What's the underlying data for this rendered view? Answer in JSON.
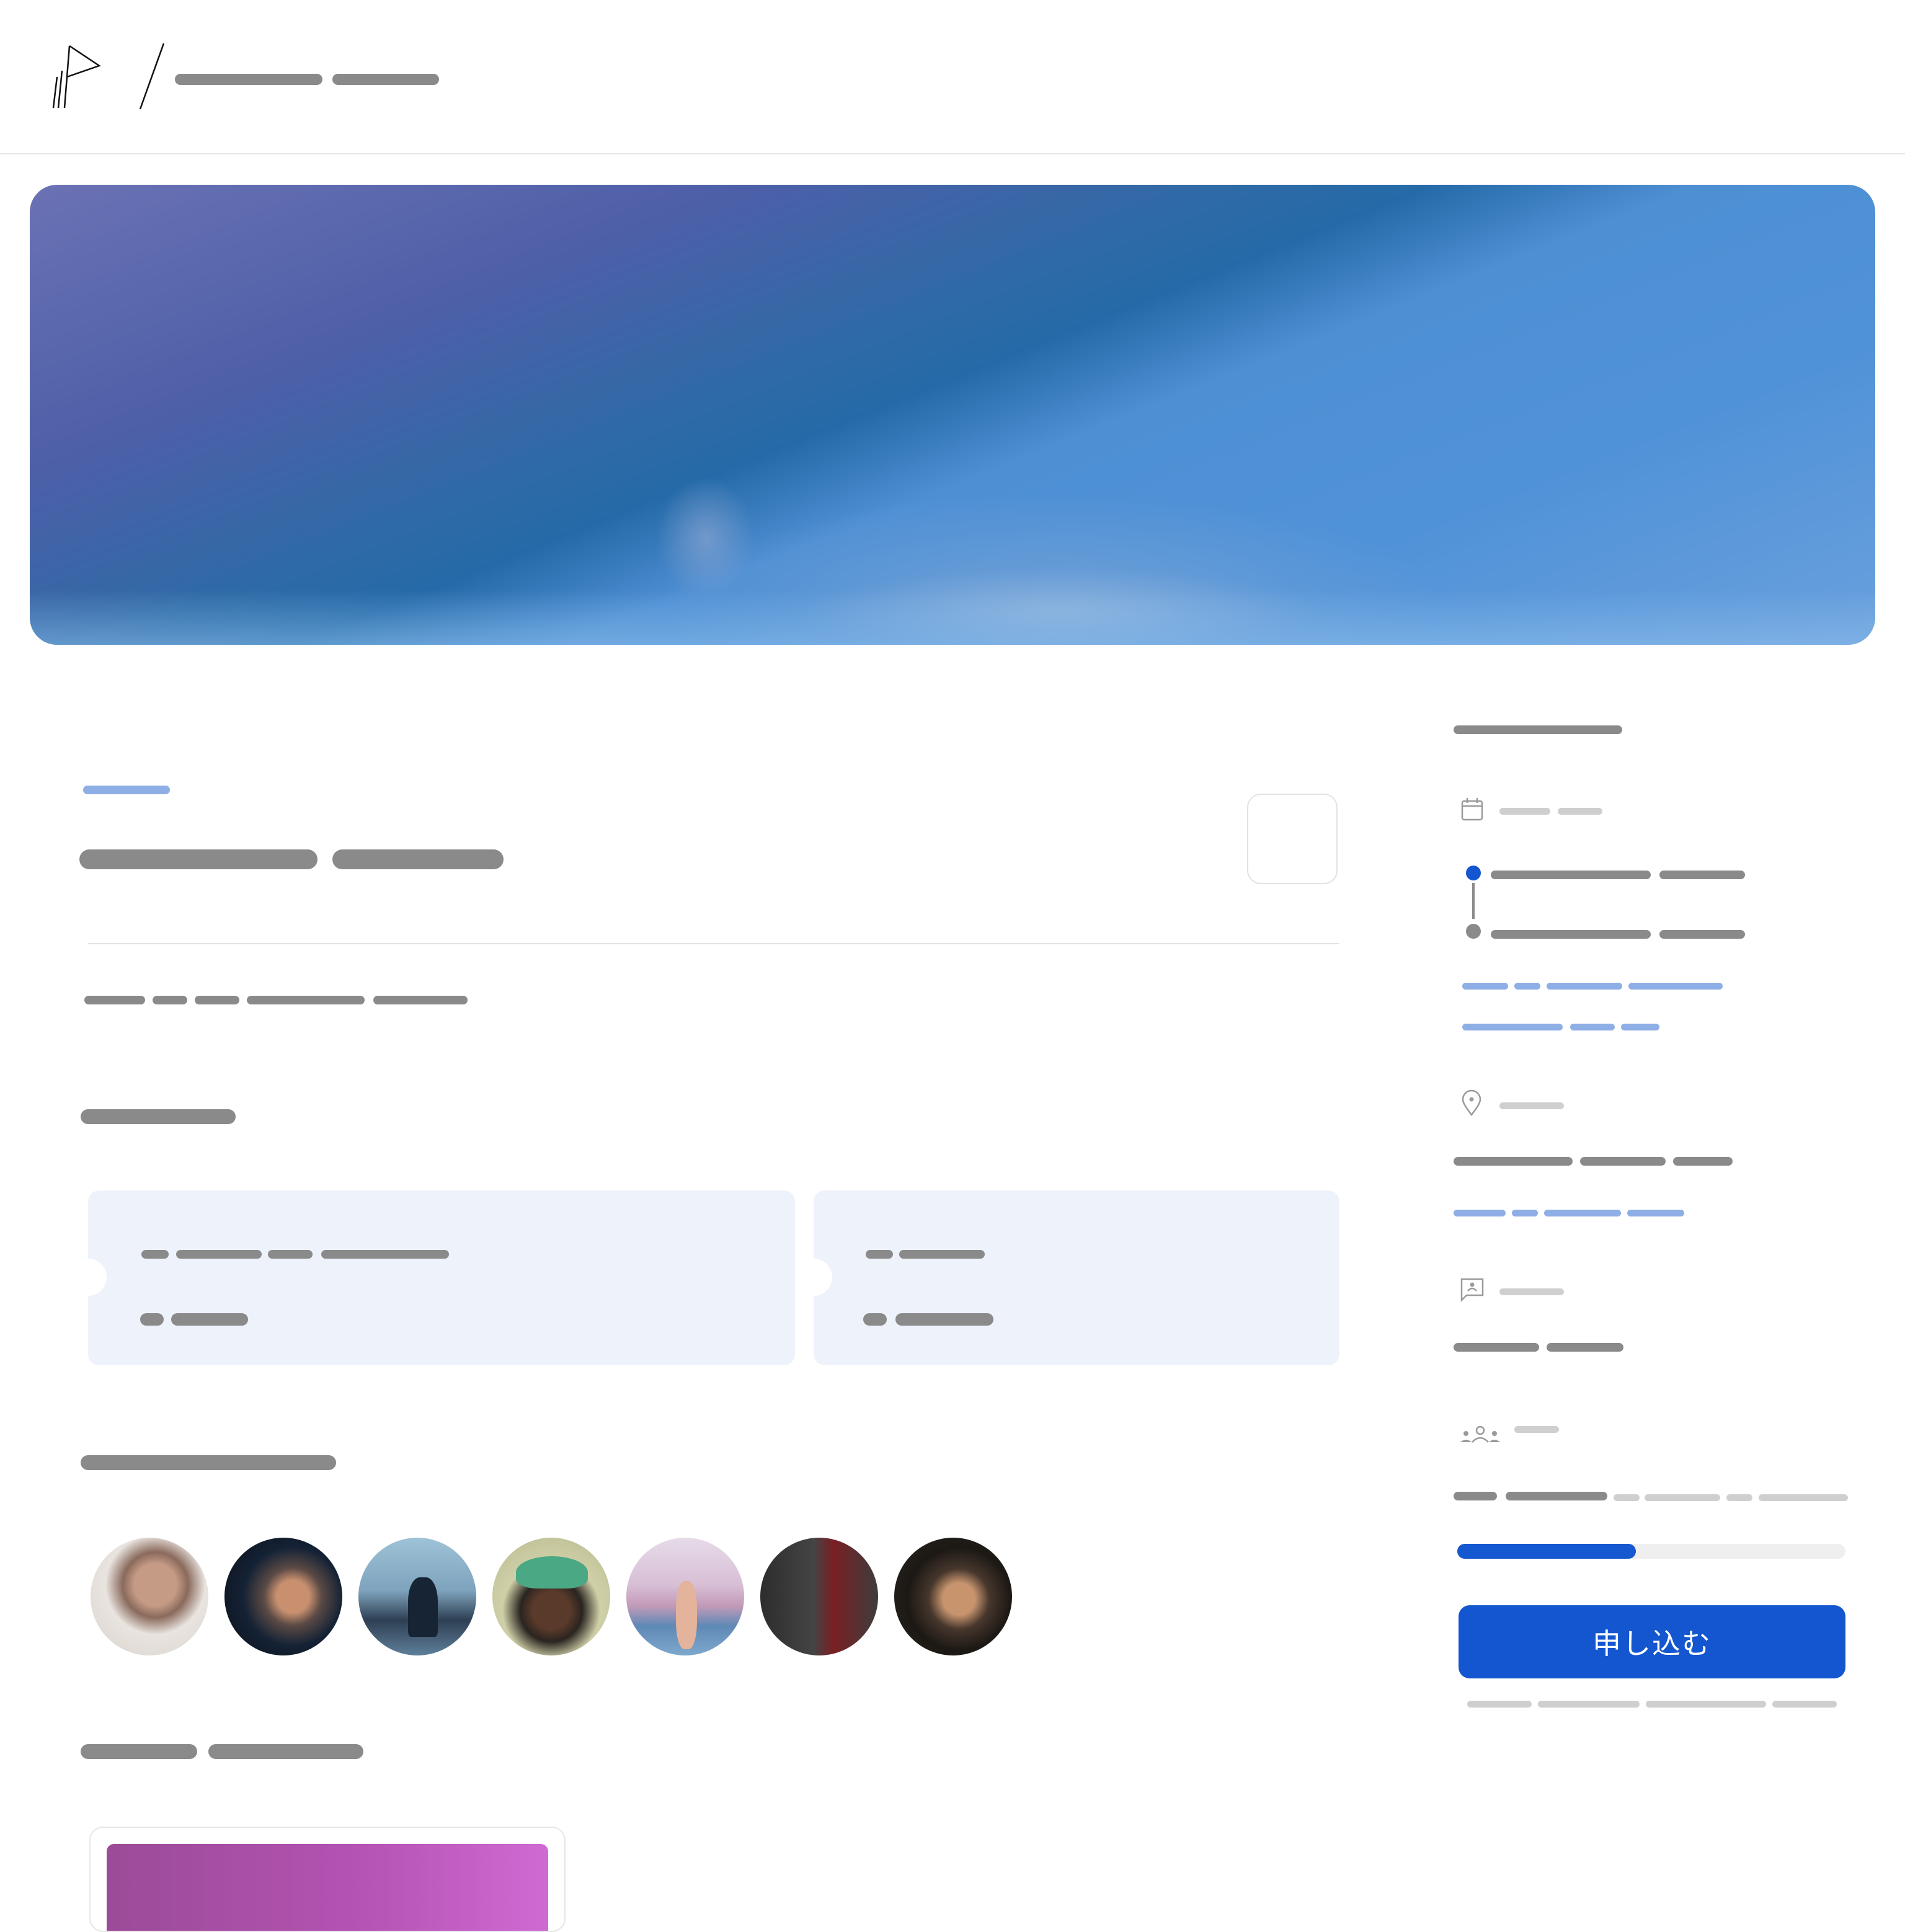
{
  "header": {
    "logo_icon": "flag-logo-icon",
    "separator": "/"
  },
  "sidebar": {
    "icons": [
      "calendar-icon",
      "location-pin-icon",
      "message-icon",
      "people-icon"
    ],
    "registration_progress": 0.46,
    "apply_button_label": "申し込む"
  },
  "main": {
    "attendee_avatars": 7
  },
  "colors": {
    "accent_blue": "#1456d0",
    "link_blue": "#8eaee6",
    "ticket_bg": "#eef2fa",
    "placeholder_gray": "#8a8a8a"
  }
}
